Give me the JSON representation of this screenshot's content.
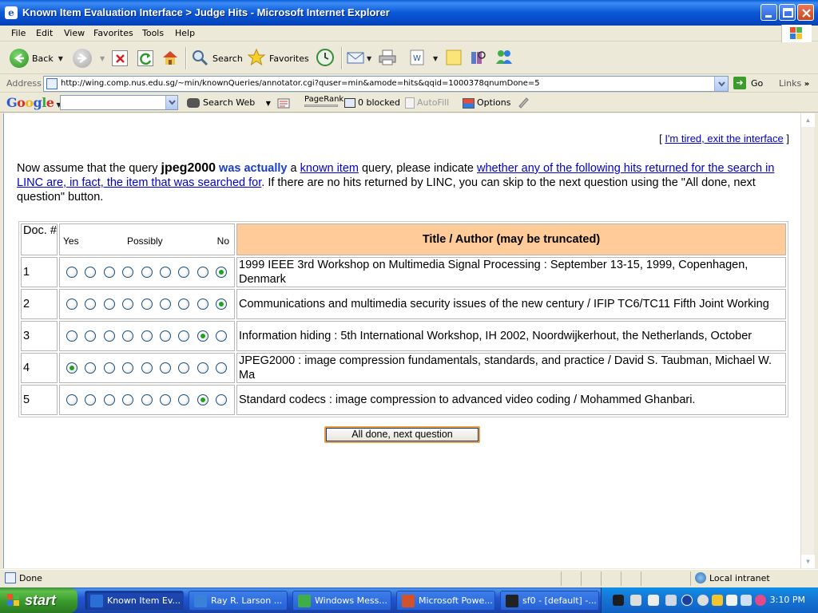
{
  "window": {
    "title": "Known Item Evaluation Interface > Judge Hits - Microsoft Internet Explorer"
  },
  "menu": [
    "File",
    "Edit",
    "View",
    "Favorites",
    "Tools",
    "Help"
  ],
  "toolbar": {
    "back_label": "Back",
    "search_label": "Search",
    "favorites_label": "Favorites"
  },
  "address": {
    "label": "Address",
    "url": "http://wing.comp.nus.edu.sg/~min/knownQueries/annotator.cgi?quser=min&amode=hits&qqid=1000378qnumDone=5",
    "go_label": "Go",
    "links_label": "Links"
  },
  "google_bar": {
    "logo": "Google",
    "search_web_label": "Search Web",
    "pagerank_label": "PageRank",
    "blocked_label": "0 blocked",
    "autofill_label": "AutoFill",
    "options_label": "Options"
  },
  "page": {
    "exit_link": "I'm tired, exit the interface",
    "intro_1": "Now assume that the query ",
    "query_term": "jpeg2000",
    "was_actually": " was actually",
    "intro_2": " a ",
    "known_item_link": "known item",
    "intro_3": " query, please indicate ",
    "whether_link": "whether any of the following hits returned for the search in LINC are, in fact, the item that was searched for",
    "intro_4": ". If there are no hits returned by LINC, you can skip to the next question using the \"All done, next question\" button.",
    "table": {
      "doc_header": "Doc. #",
      "scale_yes": "Yes",
      "scale_possibly": "Possibly",
      "scale_no": "No",
      "title_header": "Title / Author (may be truncated)",
      "rows": [
        {
          "doc": "1",
          "title": "1999 IEEE 3rd Workshop on Multimedia Signal Processing : September 13-15, 1999, Copenhagen, Denmark",
          "selected": 9
        },
        {
          "doc": "2",
          "title": "Communications and multimedia security issues of the new century / IFIP TC6/TC11 Fifth Joint Working",
          "selected": 9
        },
        {
          "doc": "3",
          "title": "Information hiding : 5th International Workshop, IH 2002, Noordwijkerhout, the Netherlands, October",
          "selected": 8
        },
        {
          "doc": "4",
          "title": "JPEG2000 : image compression fundamentals, standards, and practice / David S. Taubman, Michael W. Ma",
          "selected": 1
        },
        {
          "doc": "5",
          "title": "Standard codecs : image compression to advanced video coding / Mohammed Ghanbari.",
          "selected": 8
        }
      ],
      "scale_points": 9
    },
    "done_button": "All done, next question"
  },
  "status": {
    "text": "Done",
    "zone": "Local intranet"
  },
  "taskbar": {
    "start_label": "start",
    "tasks": [
      {
        "label": "Known Item Ev...",
        "icon_color": "#2a6fd6",
        "active": true
      },
      {
        "label": "Ray R. Larson ...",
        "icon_color": "#3a82d9",
        "active": false
      },
      {
        "label": "Windows Mess...",
        "icon_color": "#3fae49",
        "active": false
      },
      {
        "label": "Microsoft Powe...",
        "icon_color": "#d2532b",
        "active": false
      },
      {
        "label": "sf0 - [default] -...",
        "icon_color": "#222222",
        "active": false
      }
    ],
    "clock": "3:10 PM"
  }
}
